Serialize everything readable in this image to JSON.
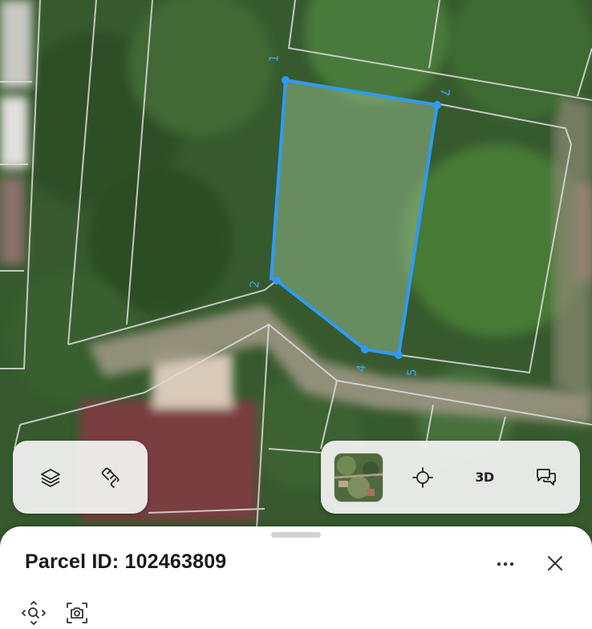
{
  "map": {
    "vertex_labels": [
      "1",
      "7",
      "2",
      "4",
      "5"
    ],
    "colors": {
      "parcel_outline": "#2f9bf5",
      "parcel_fill": "#8fb78a",
      "cadastral_lines": "#dcdcdc"
    }
  },
  "left_toolbar": {
    "items": [
      {
        "icon": "layers-icon"
      },
      {
        "icon": "ruler-icon"
      }
    ]
  },
  "right_toolbar": {
    "satellite_thumbnail": "satellite-thumbnail",
    "locate_icon": "crosshair-icon",
    "three_d_label": "3D",
    "feedback_icon": "chat-bubble-icon"
  },
  "sheet": {
    "title": "Parcel ID: 102463809",
    "more_icon": "more-horizontal-icon",
    "close_icon": "close-icon",
    "actions": [
      {
        "icon": "zoom-to-icon"
      },
      {
        "icon": "screenshot-icon"
      }
    ]
  }
}
